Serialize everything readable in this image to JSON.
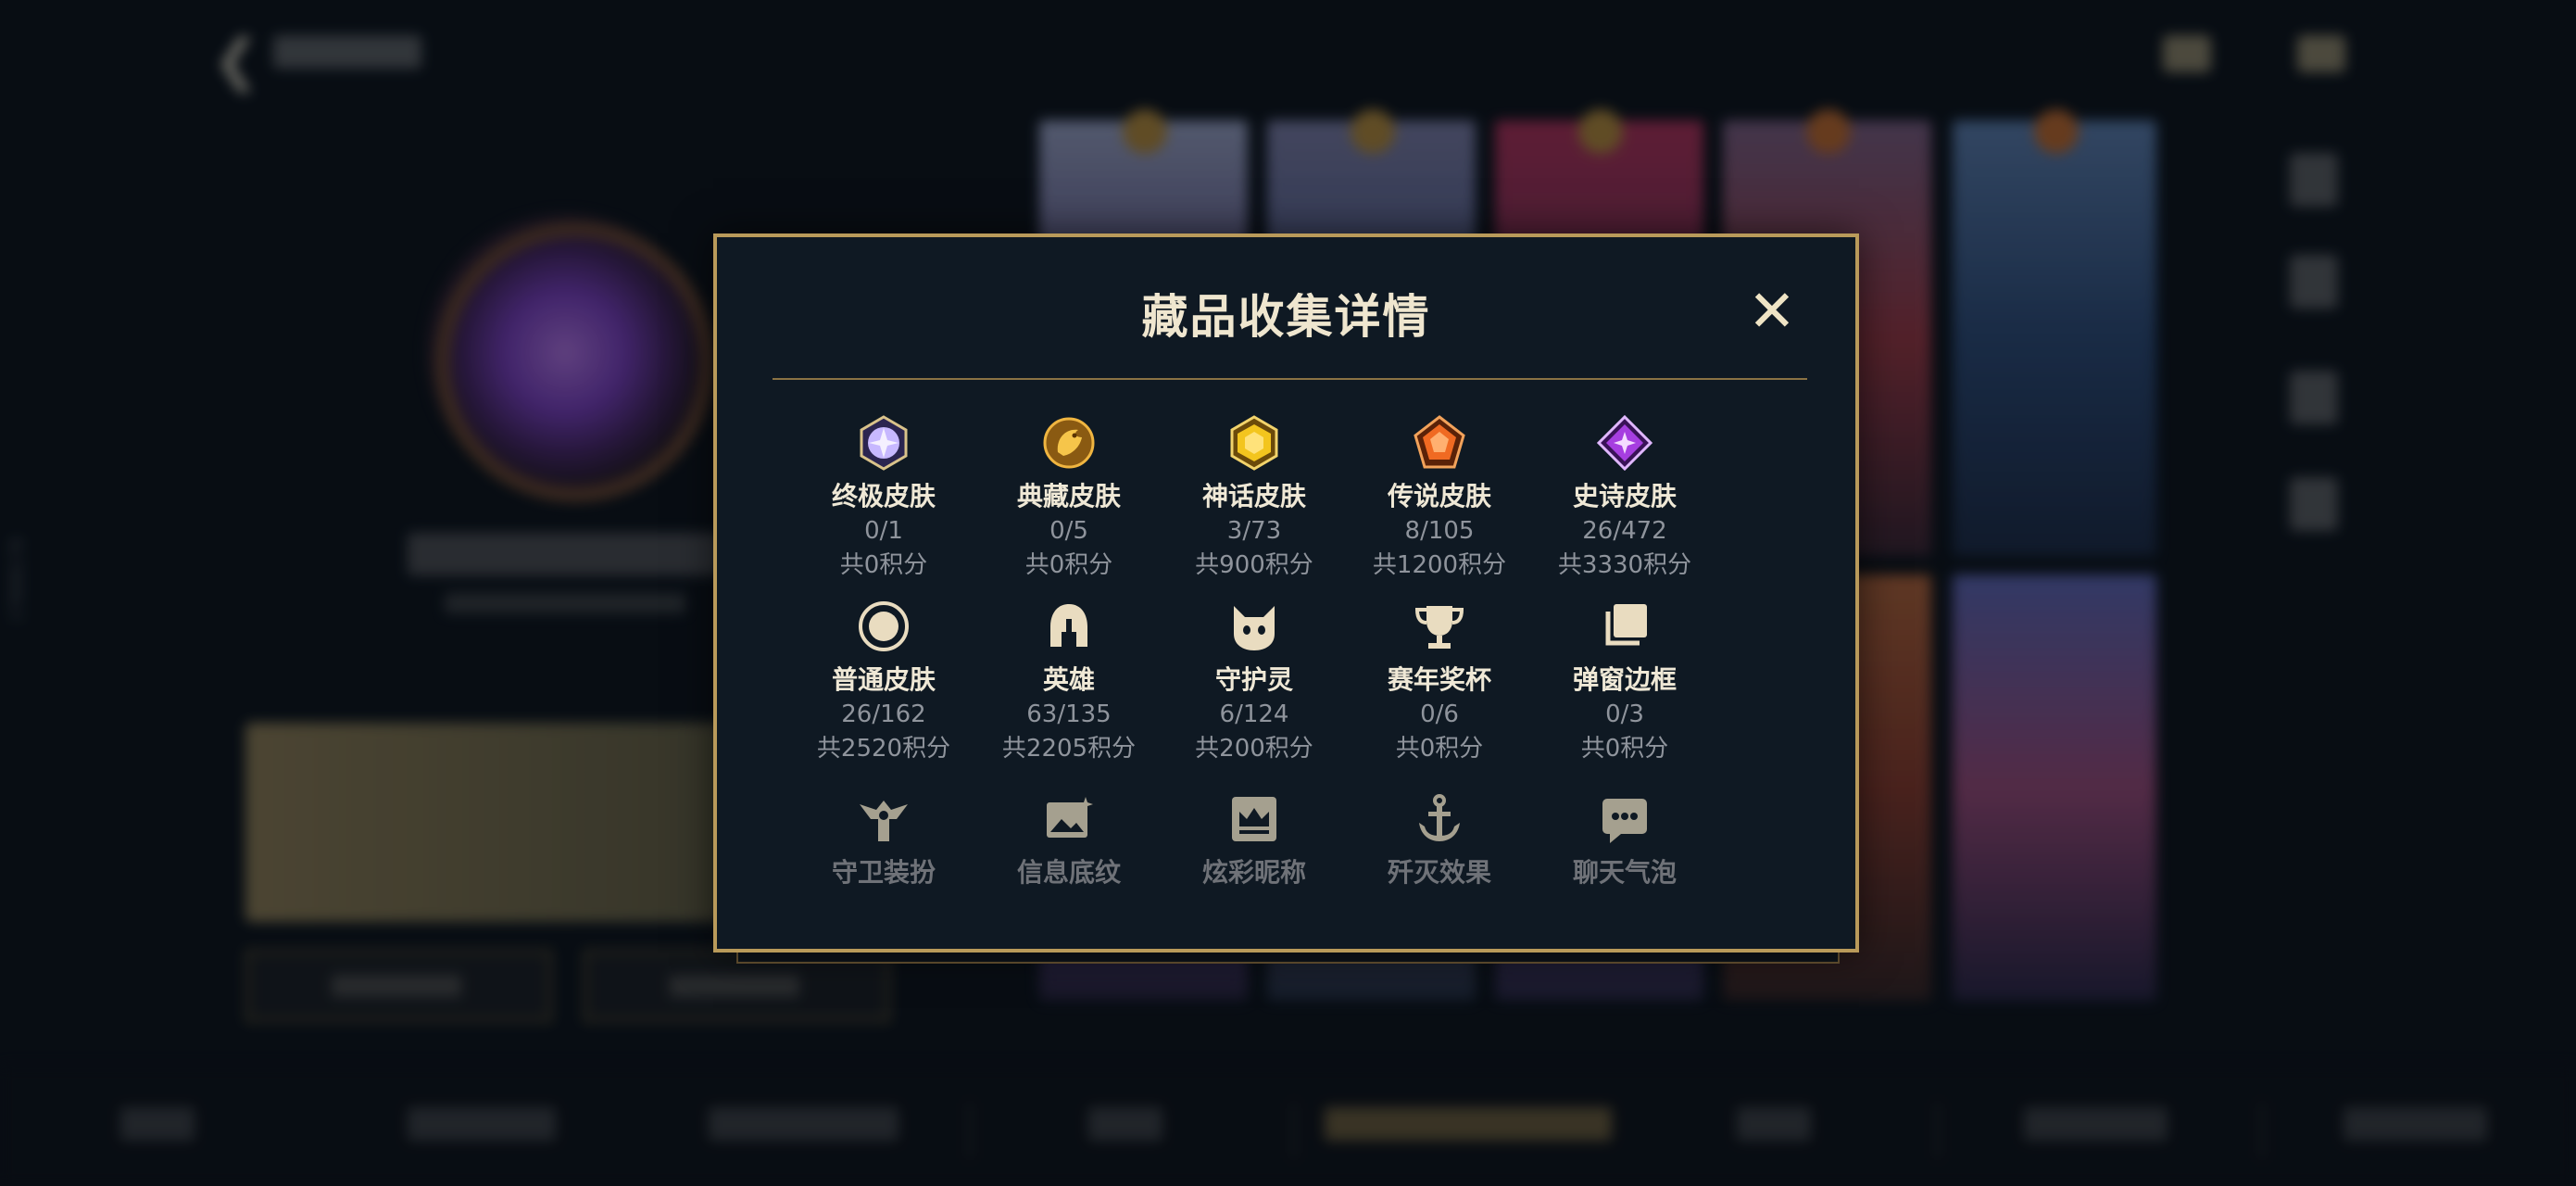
{
  "dialog": {
    "title": "藏品收集详情",
    "close_label": "✕"
  },
  "collections": [
    {
      "name": "终极皮肤",
      "count": "0/1",
      "points": "共0积分",
      "icon": "ultimate-skin-icon",
      "color": "#b9a6ff"
    },
    {
      "name": "典藏皮肤",
      "count": "0/5",
      "points": "共0积分",
      "icon": "prestige-skin-icon",
      "color": "#d79a2b"
    },
    {
      "name": "神话皮肤",
      "count": "3/73",
      "points": "共900积分",
      "icon": "mythic-skin-icon",
      "color": "#f1c21b"
    },
    {
      "name": "传说皮肤",
      "count": "8/105",
      "points": "共1200积分",
      "icon": "legendary-skin-icon",
      "color": "#f0742a"
    },
    {
      "name": "史诗皮肤",
      "count": "26/472",
      "points": "共3330积分",
      "icon": "epic-skin-icon",
      "color": "#b24ce0"
    },
    {
      "name": "普通皮肤",
      "count": "26/162",
      "points": "共2520积分",
      "icon": "normal-skin-icon",
      "color": "#e9dcc0"
    },
    {
      "name": "英雄",
      "count": "63/135",
      "points": "共2205积分",
      "icon": "champion-helmet-icon",
      "color": "#e9dcc0"
    },
    {
      "name": "守护灵",
      "count": "6/124",
      "points": "共200积分",
      "icon": "guardian-spirit-icon",
      "color": "#e9dcc0"
    },
    {
      "name": "赛年奖杯",
      "count": "0/6",
      "points": "共0积分",
      "icon": "trophy-icon",
      "color": "#e9dcc0"
    },
    {
      "name": "弹窗边框",
      "count": "0/3",
      "points": "共0积分",
      "icon": "popup-frame-icon",
      "color": "#e9dcc0"
    },
    {
      "name": "守卫装扮",
      "icon": "ward-skin-icon",
      "color": "#d8cdb4"
    },
    {
      "name": "信息底纹",
      "icon": "info-pattern-icon",
      "color": "#d8cdb4"
    },
    {
      "name": "炫彩昵称",
      "icon": "colorful-name-icon",
      "color": "#d8cdb4"
    },
    {
      "name": "歼灭效果",
      "icon": "annihilation-effect-icon",
      "color": "#d8cdb4"
    },
    {
      "name": "聊天气泡",
      "icon": "chat-bubble-icon",
      "color": "#d8cdb4"
    }
  ],
  "background": {
    "side_id": "17808178"
  }
}
